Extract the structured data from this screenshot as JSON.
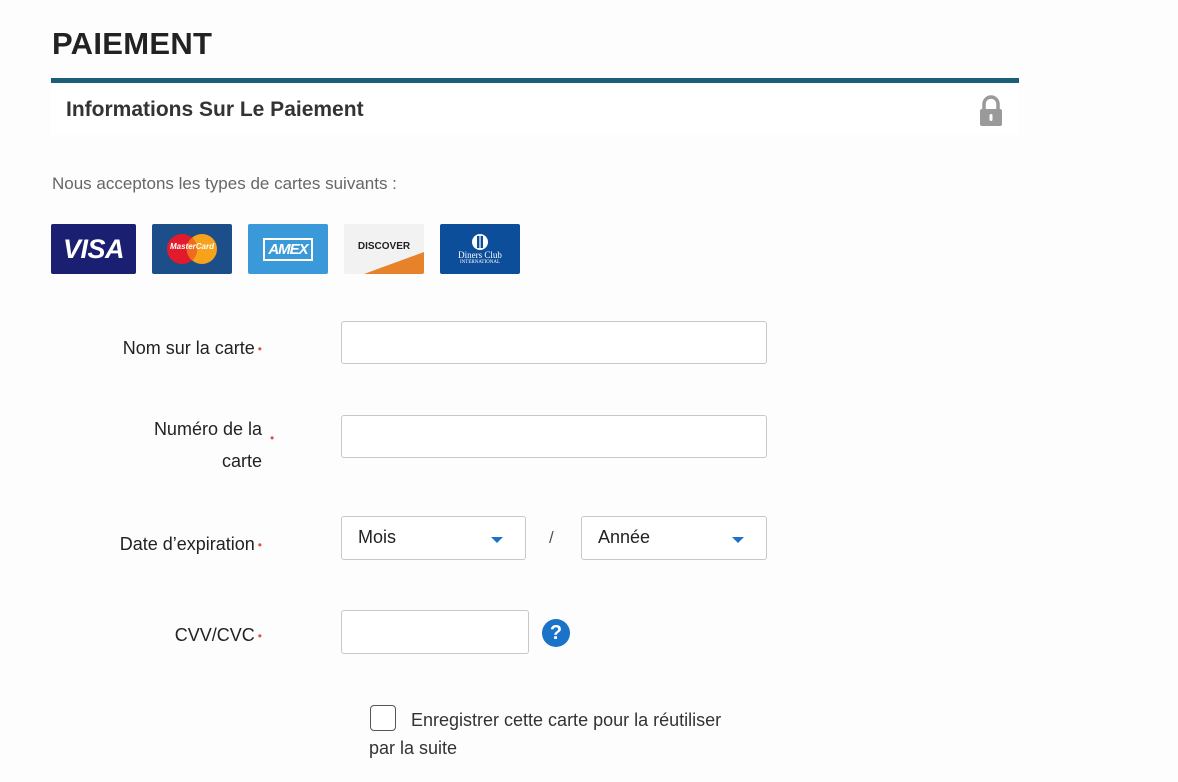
{
  "page": {
    "title": "PAIEMENT"
  },
  "section": {
    "title": "Informations Sur Le Paiement",
    "lock_icon": "lock-icon"
  },
  "accepted_cards": {
    "intro": "Nous acceptons les types de cartes suivants :",
    "cards": [
      {
        "name": "VISA",
        "logo_text": "VISA",
        "color": "#1a1f71"
      },
      {
        "name": "MasterCard",
        "logo_text": "MasterCard",
        "color": "#1c4f8a"
      },
      {
        "name": "AMEX",
        "logo_text": "AMEX",
        "color": "#3a9ad9"
      },
      {
        "name": "DISCOVER",
        "logo_text": "DISCOVER",
        "color": "#f2f2f2"
      },
      {
        "name": "Diners Club",
        "logo_text": "Diners Club",
        "sub_text": "INTERNATIONAL",
        "color": "#0d4e9a"
      }
    ]
  },
  "form": {
    "required_marker": "•",
    "name_on_card": {
      "label": "Nom sur la carte",
      "value": "",
      "placeholder": ""
    },
    "card_number": {
      "label": "Numéro de la carte",
      "value": "",
      "placeholder": ""
    },
    "expiration": {
      "label": "Date d’expiration",
      "month": {
        "selected": "Mois"
      },
      "year": {
        "selected": "Année"
      },
      "separator": "/"
    },
    "cvv": {
      "label": "CVV/CVC",
      "value": "",
      "help_icon": "question-circle-icon",
      "help_glyph": "?"
    },
    "save_card": {
      "label": "Enregistrer cette carte pour la réutiliser par la suite",
      "checked": false
    }
  },
  "colors": {
    "title_bar": "#1a5f7a",
    "required": "#d9534f",
    "accent": "#1a73c9"
  }
}
